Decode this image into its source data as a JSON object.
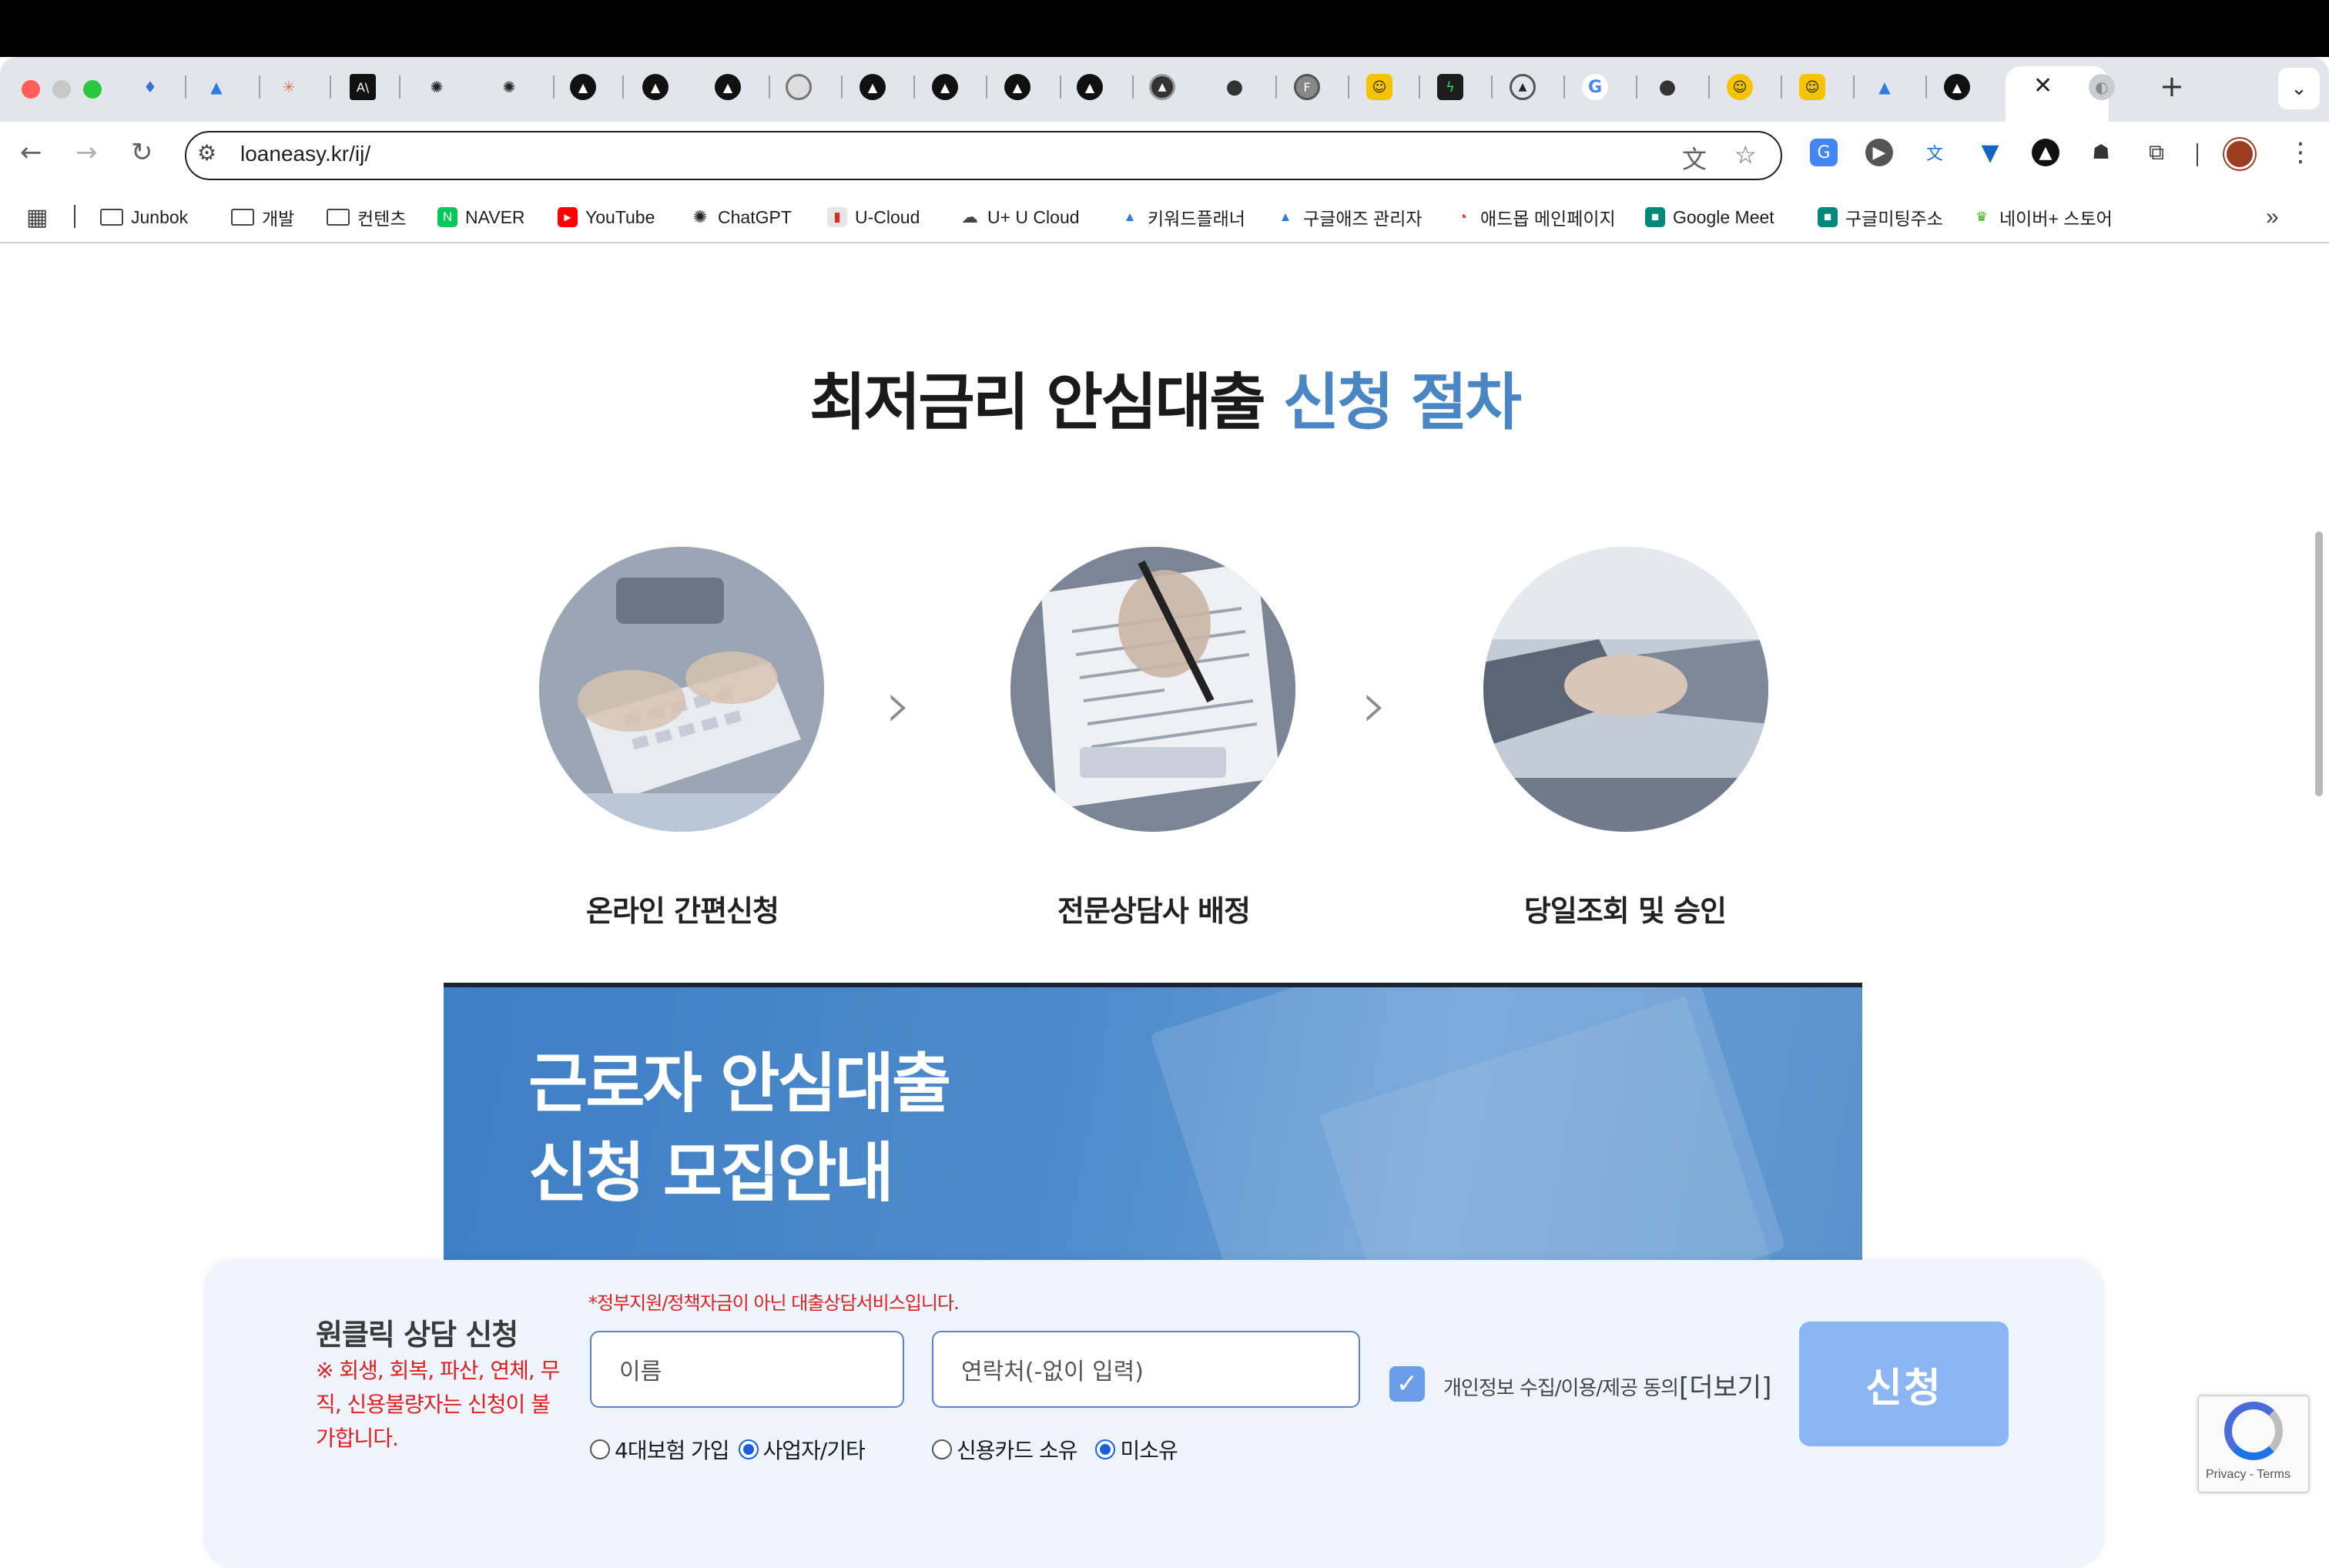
{
  "browser": {
    "url": "loaneasy.kr/ij/",
    "bookmarks": [
      "Junbok",
      "개발",
      "컨텐츠",
      "NAVER",
      "YouTube",
      "ChatGPT",
      "U-Cloud",
      "U+ U Cloud",
      "키워드플래너",
      "구글애즈 관리자",
      "애드몹 메인페이지",
      "Google Meet",
      "구글미팅주소",
      "네이버+ 스토어"
    ],
    "more_bookmarks": "»"
  },
  "page": {
    "heading_main": "최저금리 안심대출 ",
    "heading_accent": "신청 절차",
    "steps": [
      {
        "label": "온라인 간편신청"
      },
      {
        "label": "전문상담사 배정"
      },
      {
        "label": "당일조회 및 승인"
      }
    ],
    "arrow": "›",
    "banner_line1": "근로자 안심대출",
    "banner_line2": "신청 모집안내"
  },
  "form": {
    "title": "원클릭 상담 신청",
    "warning": "※ 회생, 회복, 파산, 연체, 무직, 신용불량자는 신청이 불가합니다.",
    "notice": "*정부지원/정책자금이 아닌 대출상담서비스입니다.",
    "name_placeholder": "이름",
    "phone_placeholder": "연락처(-없이 입력)",
    "employment_options": [
      "4대보험 가입",
      "사업자/기타"
    ],
    "employment_selected": "사업자/기타",
    "card_options": [
      "신용카드 소유",
      "미소유"
    ],
    "card_selected": "미소유",
    "agree_text": "개인정보 수집/이용/제공 동의",
    "agree_more": "[더보기]",
    "submit_label": "신청"
  },
  "recaptcha": {
    "footer": "Privacy - Terms"
  },
  "colors": {
    "accent": "#4b86c4",
    "banner": "#4a88c9",
    "warning": "#e02020",
    "submit": "#8cb5f3"
  }
}
